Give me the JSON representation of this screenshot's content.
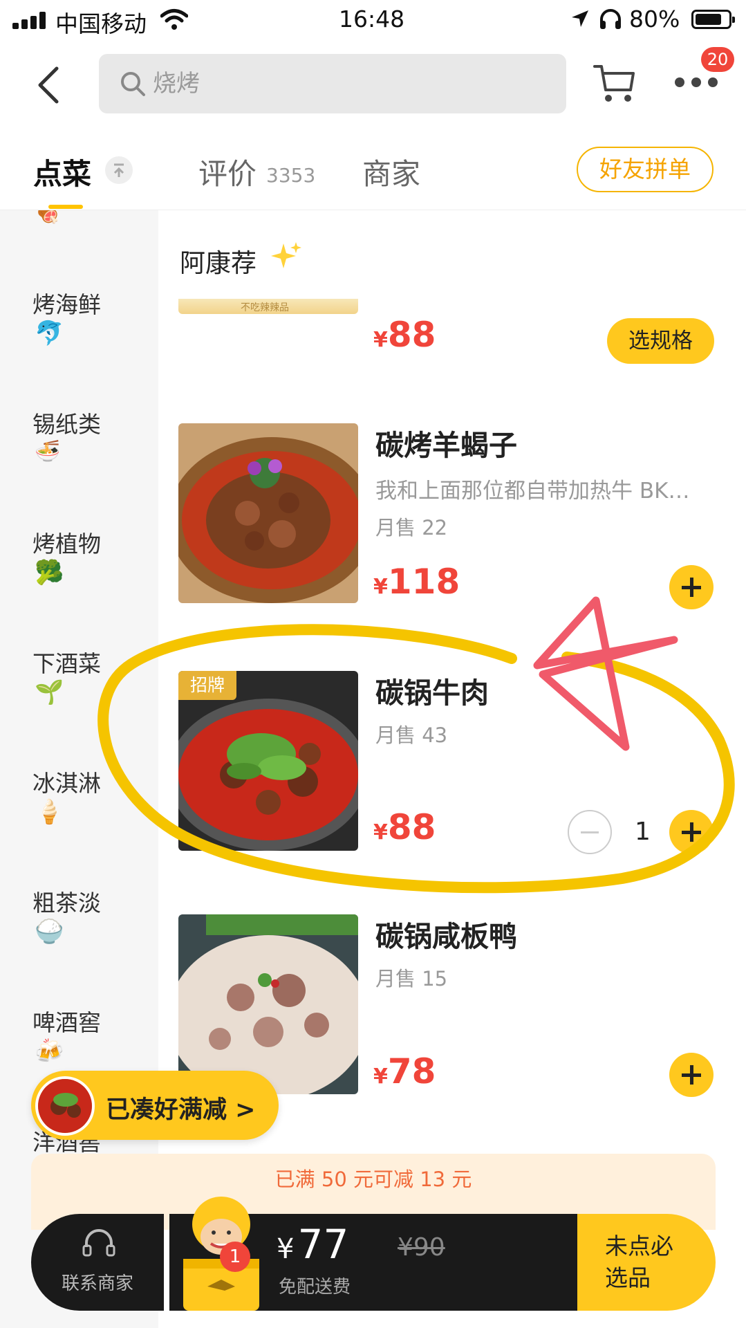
{
  "status_bar": {
    "carrier": "中国移动",
    "time": "16:48",
    "battery": "80%"
  },
  "search": {
    "placeholder": "烧烤"
  },
  "header": {
    "more_badge": "20"
  },
  "tabs": [
    {
      "label": "点菜"
    },
    {
      "label": "评价",
      "count": "3353"
    },
    {
      "label": "商家"
    }
  ],
  "group_order_label": "好友拼单",
  "sidebar": {
    "items": [
      {
        "label": "烤海鲜",
        "emoji": "🐬"
      },
      {
        "label": "锡纸类",
        "emoji": "🍜"
      },
      {
        "label": "烤植物",
        "emoji": "🥦"
      },
      {
        "label": "下酒菜",
        "emoji": "🌱"
      },
      {
        "label": "冰淇淋",
        "emoji": "🍦"
      },
      {
        "label": "粗茶淡",
        "emoji": "🍚"
      },
      {
        "label": "啤酒窖",
        "emoji": "🍻"
      },
      {
        "label": "洋酒窖"
      }
    ]
  },
  "section": {
    "title": "阿康荐"
  },
  "prev_item": {
    "currency": "¥",
    "price": "88",
    "spec_label": "选规格"
  },
  "dishes": [
    {
      "name": "碳烤羊蝎子",
      "desc": "我和上面那位都自带加热牛 BK…",
      "sales": "月售 22",
      "currency": "¥",
      "price": "118"
    },
    {
      "name": "碳锅牛肉",
      "badge": "招牌",
      "sales": "月售 43",
      "currency": "¥",
      "price": "88",
      "qty": "1"
    },
    {
      "name": "碳锅咸板鸭",
      "sales": "月售 15",
      "currency": "¥",
      "price": "78"
    }
  ],
  "promo": {
    "label": "已凑好满减 >"
  },
  "discount_banner": "已满 50 元可减 13 元",
  "bottom_bar": {
    "contact_label": "联系商家",
    "cart_count": "1",
    "currency": "¥",
    "total": "77",
    "original_price": "¥90",
    "delivery_note": "免配送费",
    "checkout_label": "未点必选品"
  },
  "colors": {
    "accent": "#ffc81e",
    "price": "#f0453a",
    "annotation_yellow": "#f5c400",
    "annotation_red": "#f05a6a"
  }
}
